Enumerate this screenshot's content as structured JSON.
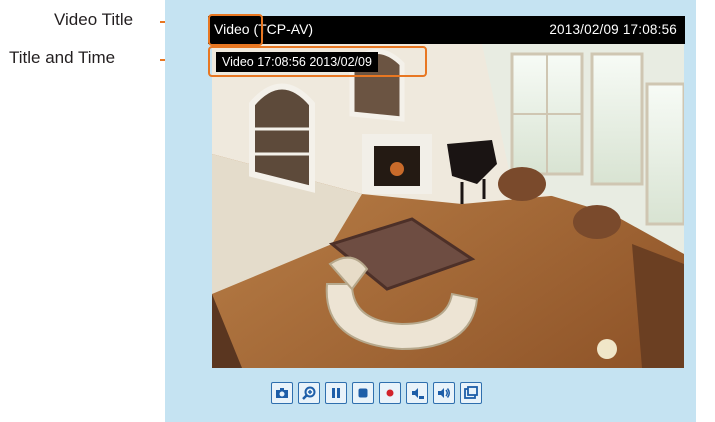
{
  "callouts": {
    "video_title": "Video Title",
    "title_and_time": "Title and Time"
  },
  "viewer": {
    "title_left": "Video (TCP-AV)",
    "title_right": "2013/02/09  17:08:56",
    "overlay": "Video 17:08:56  2013/02/09"
  },
  "controls": {
    "icons": [
      "camera-icon",
      "zoom-icon",
      "pause-icon",
      "stop-icon",
      "record-icon",
      "volume-down-icon",
      "volume-icon",
      "fullscreen-icon"
    ]
  },
  "colors": {
    "panel_bg": "#c5e3f2",
    "accent": "#e87722",
    "button_border": "#2f6fae",
    "button_icon": "#1e5ea8"
  }
}
